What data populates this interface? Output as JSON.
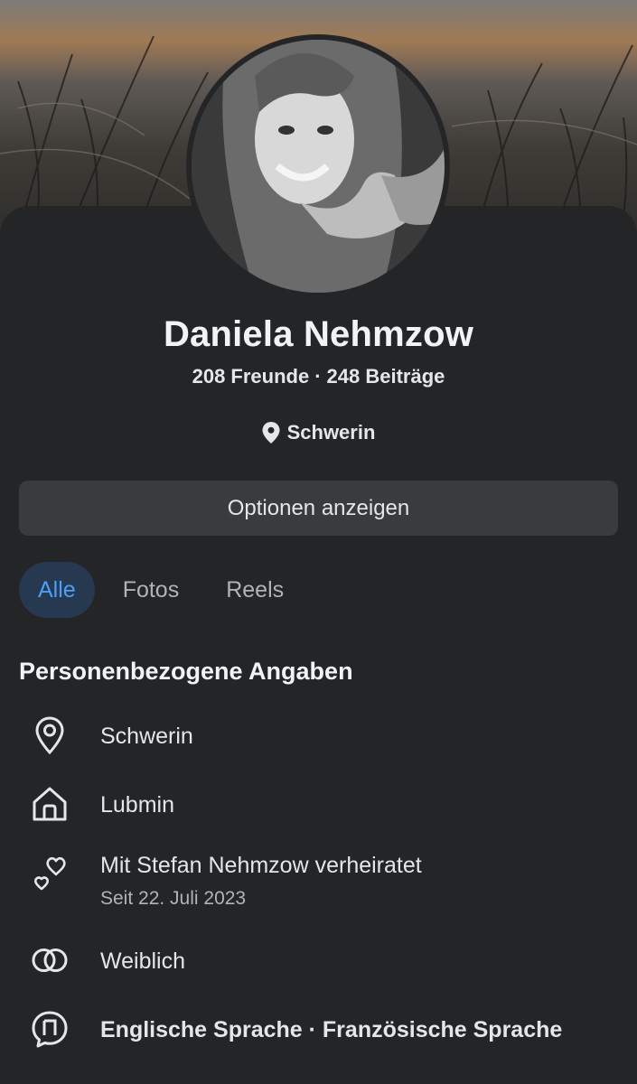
{
  "profile": {
    "name": "Daniela Nehmzow",
    "friends": "208 Freunde",
    "separator": "·",
    "posts": "248 Beiträge",
    "location": "Schwerin"
  },
  "actions": {
    "options_label": "Optionen anzeigen"
  },
  "tabs": [
    {
      "label": "Alle",
      "active": true
    },
    {
      "label": "Fotos",
      "active": false
    },
    {
      "label": "Reels",
      "active": false
    }
  ],
  "details": {
    "title": "Personenbezogene Angaben",
    "items": [
      {
        "icon": "location-pin-icon",
        "text": "Schwerin"
      },
      {
        "icon": "home-icon",
        "text": "Lubmin"
      },
      {
        "icon": "hearts-icon",
        "text": "Mit Stefan Nehmzow verheiratet",
        "sub": "Seit 22. Juli 2023"
      },
      {
        "icon": "gender-icon",
        "text": "Weiblich"
      },
      {
        "icon": "language-icon",
        "text": "Englische Sprache · Französische Sprache"
      }
    ]
  },
  "colors": {
    "background": "#242526",
    "button": "#3a3b3c",
    "tab_active_bg": "#263951",
    "tab_active_text": "#4b9ff5",
    "secondary_text": "#b0b3b8"
  }
}
